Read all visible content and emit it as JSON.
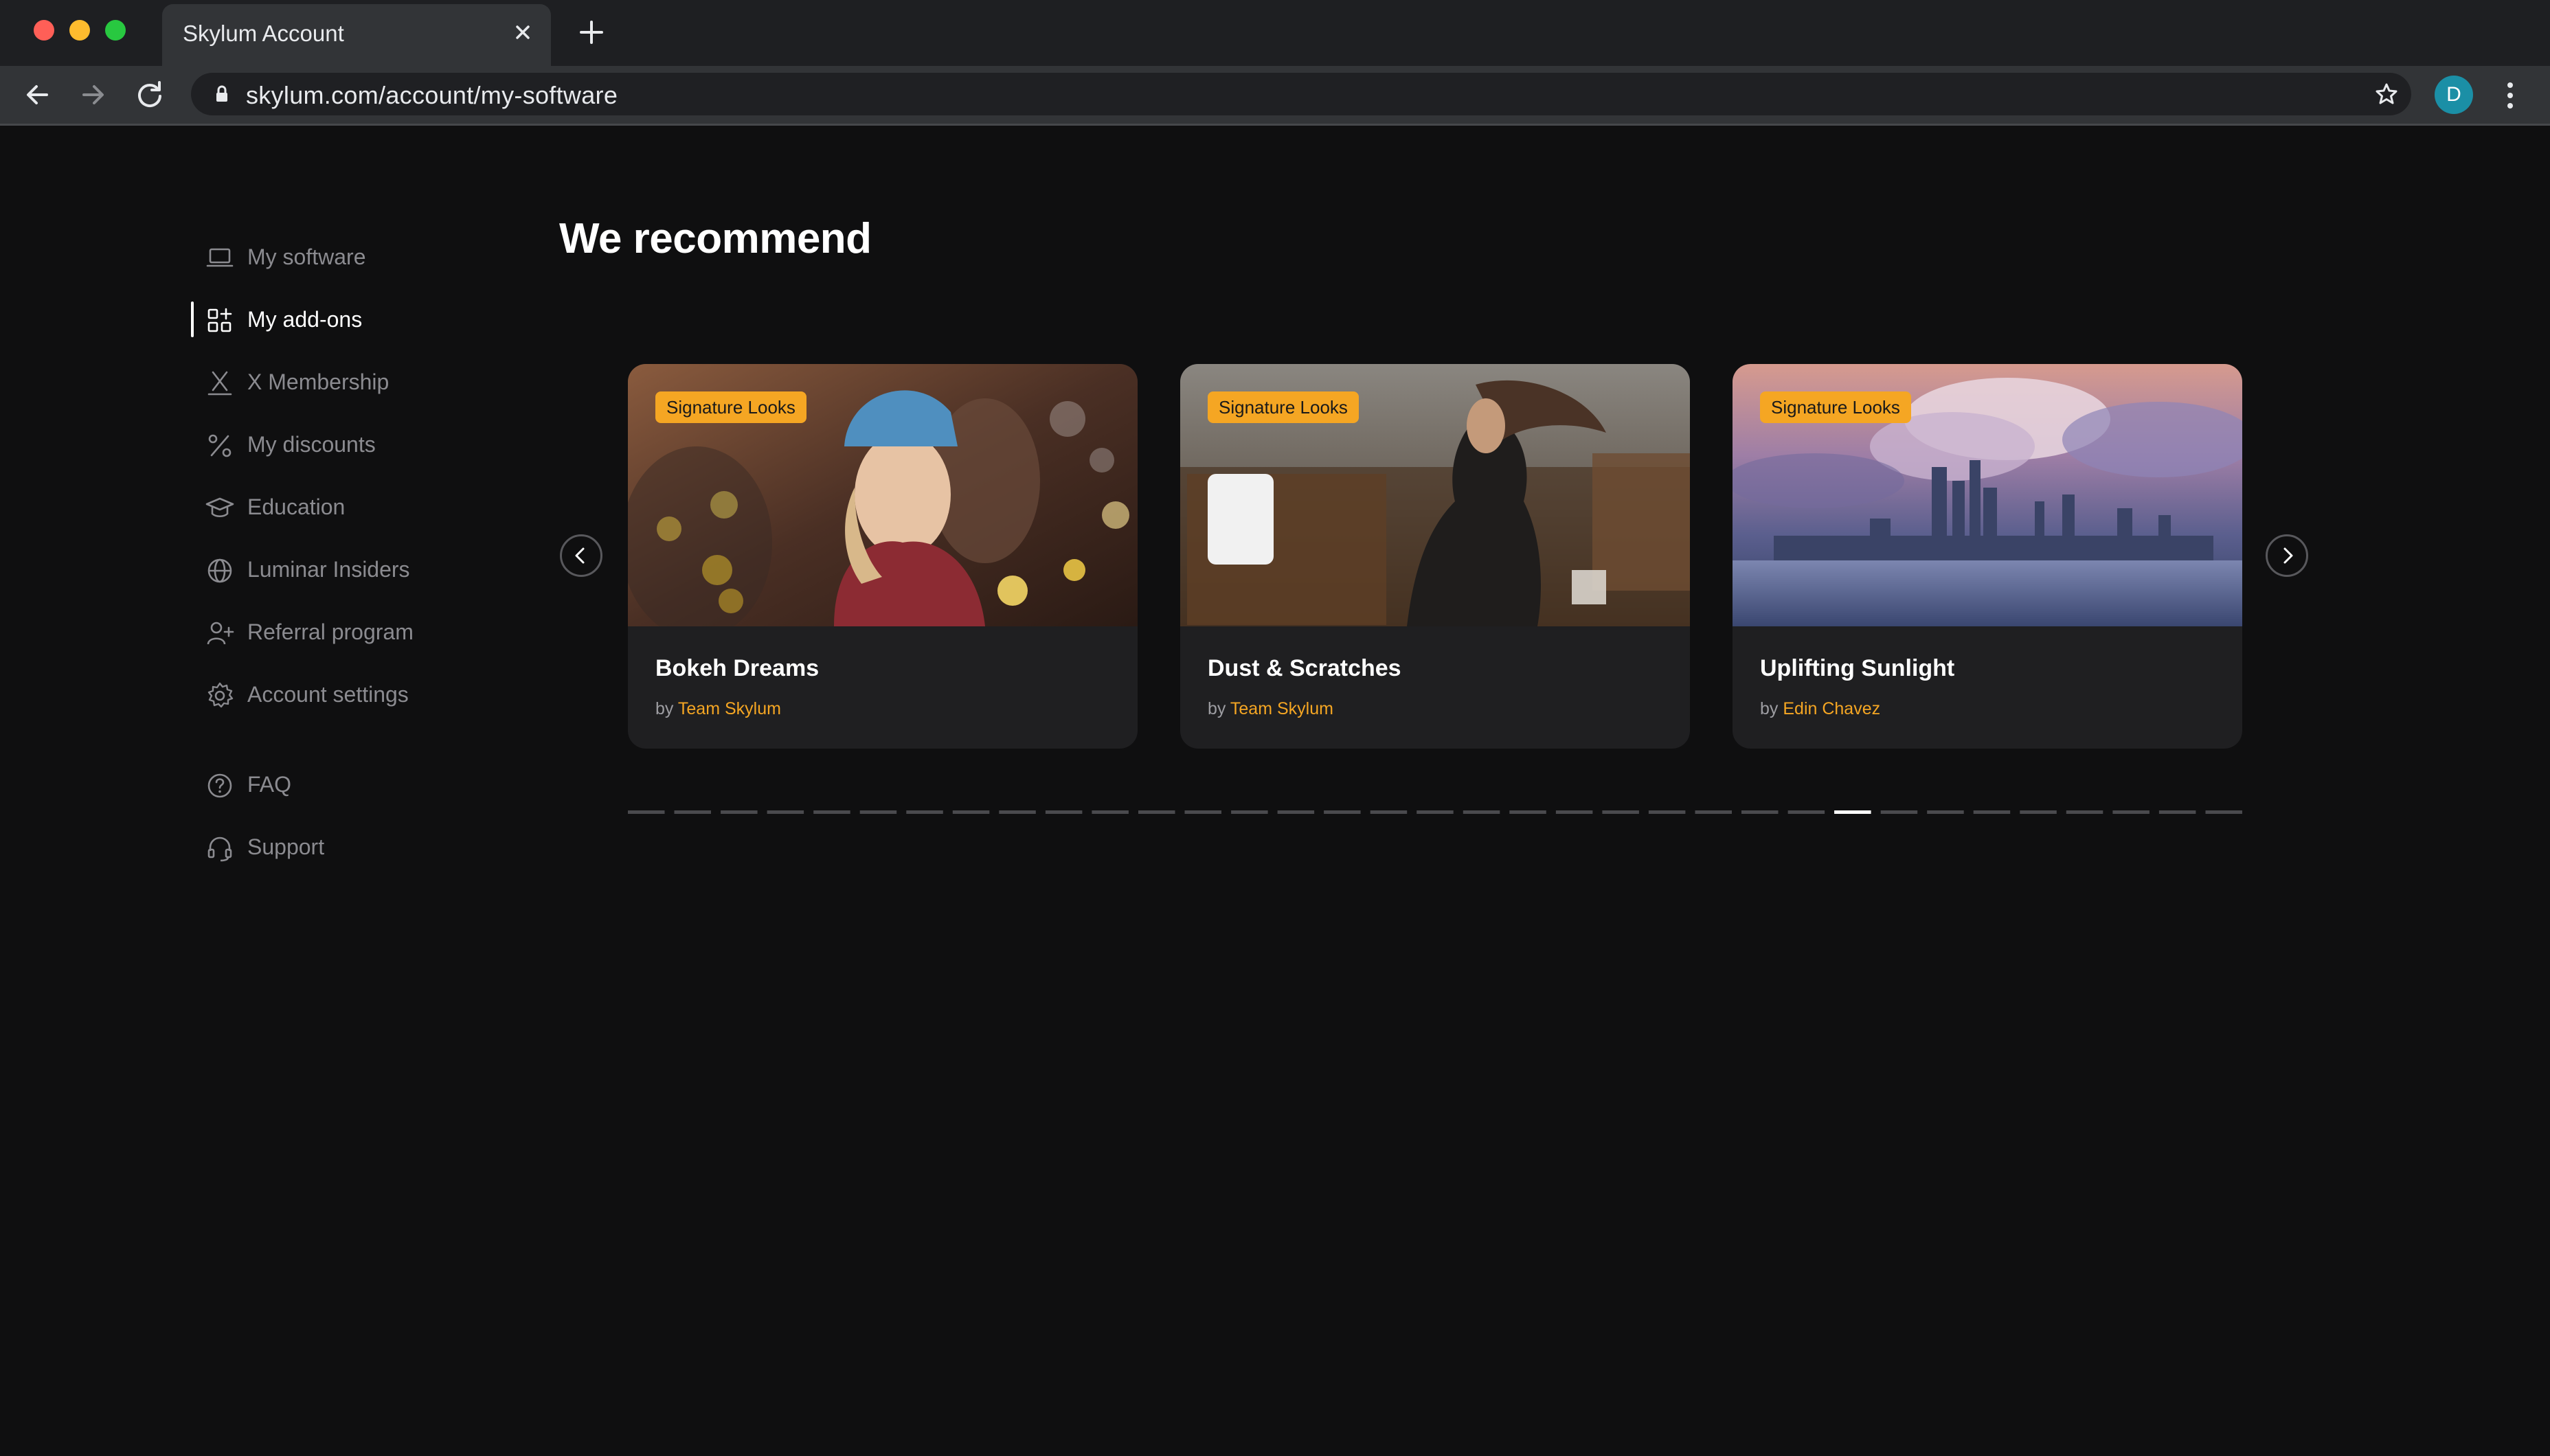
{
  "browser": {
    "tab_title": "Skylum Account",
    "url": "skylum.com/account/my-software",
    "profile_initial": "D"
  },
  "sidebar": {
    "items": [
      {
        "label": "My software",
        "icon": "laptop-icon"
      },
      {
        "label": "My add-ons",
        "icon": "add-ons-grid-icon",
        "active": true
      },
      {
        "label": "X Membership",
        "icon": "x-membership-icon"
      },
      {
        "label": "My discounts",
        "icon": "percent-icon"
      },
      {
        "label": "Education",
        "icon": "graduation-cap-icon"
      },
      {
        "label": "Luminar Insiders",
        "icon": "globe-icon"
      },
      {
        "label": "Referral program",
        "icon": "add-user-icon"
      },
      {
        "label": "Account settings",
        "icon": "gear-icon"
      },
      {
        "label": "FAQ",
        "icon": "question-circle-icon"
      },
      {
        "label": "Support",
        "icon": "headset-icon"
      }
    ]
  },
  "main": {
    "heading": "We recommend",
    "cards": [
      {
        "badge": "Signature Looks",
        "title": "Bokeh Dreams",
        "by": "by",
        "author": "Team Skylum"
      },
      {
        "badge": "Signature Looks",
        "title": "Dust & Scratches",
        "by": "by",
        "author": "Team Skylum"
      },
      {
        "badge": "Signature Looks",
        "title": "Uplifting Sunlight",
        "by": "by",
        "author": "Edin Chavez"
      }
    ],
    "pagination": {
      "total": 35,
      "current": 27
    }
  },
  "colors": {
    "background": "#0f0f10",
    "accent": "#f5a623",
    "card": "#1f1f21"
  }
}
